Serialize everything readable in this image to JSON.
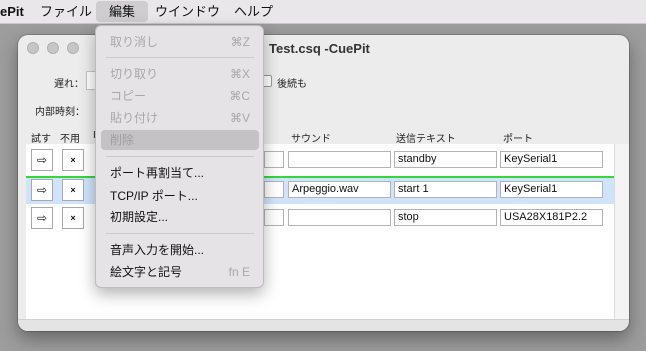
{
  "menubar": {
    "app": "ePit",
    "items": [
      "ファイル",
      "編集",
      "ウインドウ",
      "ヘルプ"
    ]
  },
  "window": {
    "title": "Test.csq -CuePit",
    "delay_label": "遅れ：",
    "continuous_label": "後続も",
    "clock_label": "内部時刻：",
    "headers": {
      "try": "試す",
      "unused": "不用",
      "extra": "I",
      "sound": "サウンド",
      "send_text": "送信テキスト",
      "port": "ポート"
    },
    "rows": [
      {
        "try_icon": "⇨",
        "remove_icon": "×",
        "sound": "",
        "text": "standby",
        "port": "KeySerial1"
      },
      {
        "try_icon": "⇨",
        "remove_icon": "×",
        "sound": "Arpeggio.wav",
        "text": "start 1",
        "port": "KeySerial1"
      },
      {
        "try_icon": "⇨",
        "remove_icon": "×",
        "sound": "",
        "text": "stop",
        "port": "USA28X181P2.2"
      }
    ]
  },
  "edit_menu": {
    "undo": {
      "label": "取り消し",
      "shortcut": "⌘Z"
    },
    "cut": {
      "label": "切り取り",
      "shortcut": "⌘X"
    },
    "copy": {
      "label": "コピー",
      "shortcut": "⌘C"
    },
    "paste": {
      "label": "貼り付け",
      "shortcut": "⌘V"
    },
    "delete": {
      "label": "削除"
    },
    "reassign_port": {
      "label": "ポート再割当て..."
    },
    "tcpip_port": {
      "label": "TCP/IP ポート..."
    },
    "preferences": {
      "label": "初期設定..."
    },
    "dictation": {
      "label": "音声入力を開始..."
    },
    "emoji": {
      "label": "絵文字と記号",
      "shortcut": "fn E"
    }
  },
  "colors": {
    "selected_row": "#cfe4fb",
    "current_cue_line": "#35d63c",
    "menu_highlight": "#c4c2c5"
  }
}
